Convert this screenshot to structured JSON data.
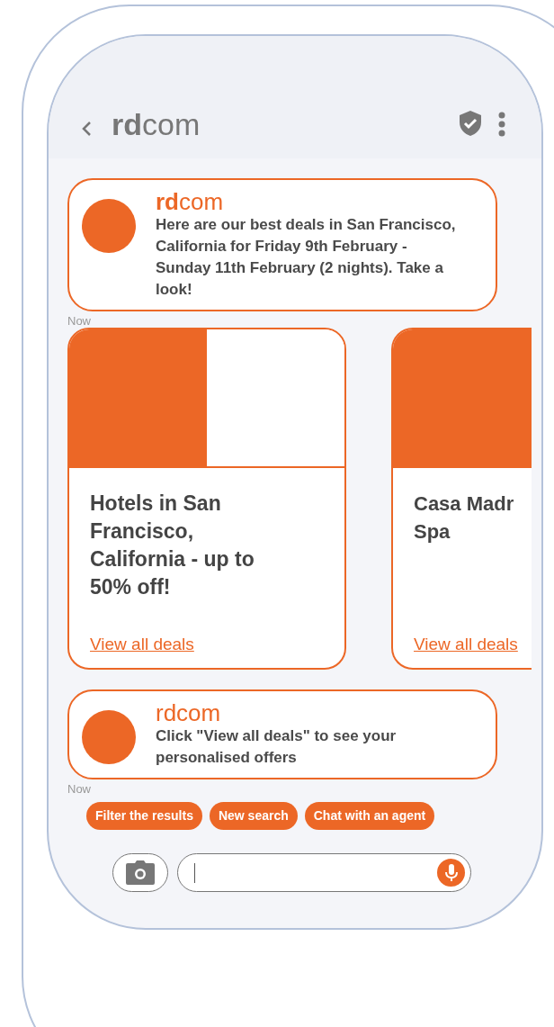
{
  "header": {
    "title": "**rd**com"
  },
  "messages": [
    {
      "sender": "**rd**com",
      "text": "Here are our best deals in San Francisco, California for Friday 9th February - Sunday 11th February (2 nights). Take a look!",
      "time": "Now"
    }
  ],
  "cards": [
    {
      "kind": "split",
      "title": "Hotels in San Francisco, California - up to 50% off!",
      "link": "View all deals"
    },
    {
      "kind": "full",
      "title": "Casa Madr Spa",
      "link": "View all deals"
    }
  ],
  "followup": {
    "sender": "rdcom",
    "text": "Click \"View all deals\" to see your personalised offers",
    "time": "Now"
  },
  "chips": [
    "Filter the results",
    "New search",
    "Chat with an agent"
  ]
}
